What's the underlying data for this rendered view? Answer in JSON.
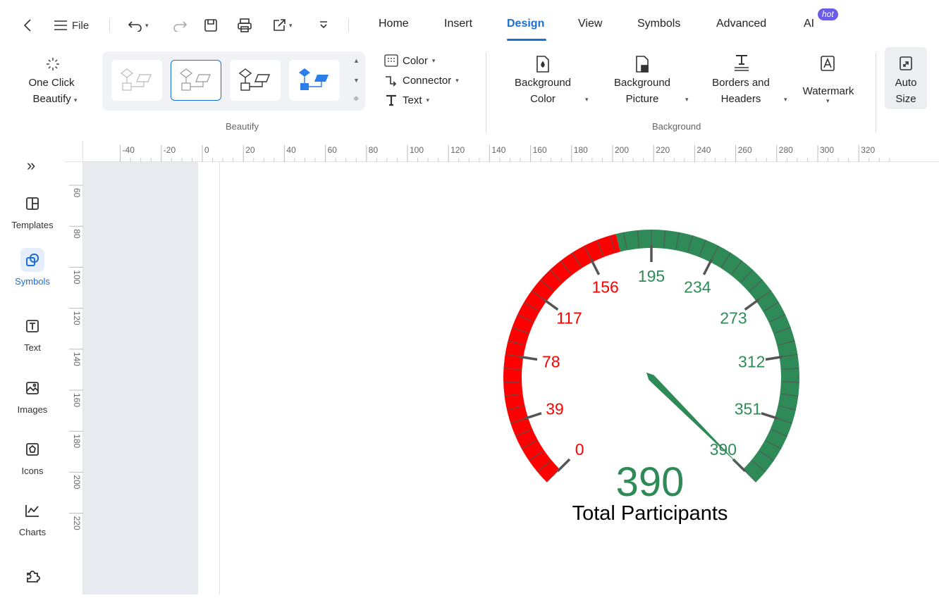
{
  "titlebar": {
    "back_icon": "chevron-left-icon",
    "file_label": "File",
    "tabs": [
      {
        "label": "Home"
      },
      {
        "label": "Insert"
      },
      {
        "label": "Design",
        "active": true
      },
      {
        "label": "View"
      },
      {
        "label": "Symbols"
      },
      {
        "label": "Advanced"
      },
      {
        "label": "AI"
      }
    ],
    "ai_badge": "hot"
  },
  "ribbon": {
    "beautify": {
      "one_click_line1": "One Click",
      "one_click_line2": "Beautify",
      "group_label": "Beautify"
    },
    "format_menu": {
      "color": "Color",
      "connector": "Connector",
      "text": "Text"
    },
    "background": {
      "bg_color_line1": "Background",
      "bg_color_line2": "Color",
      "bg_picture_line1": "Background",
      "bg_picture_line2": "Picture",
      "borders_line1": "Borders and",
      "borders_line2": "Headers",
      "watermark": "Watermark",
      "group_label": "Background"
    },
    "auto_size_line1": "Auto",
    "auto_size_line2": "Size"
  },
  "sidebar": {
    "items": [
      {
        "label": "Templates",
        "icon": "templates-icon"
      },
      {
        "label": "Symbols",
        "icon": "symbols-icon",
        "active": true
      },
      {
        "label": "Text",
        "icon": "text-icon"
      },
      {
        "label": "Images",
        "icon": "images-icon"
      },
      {
        "label": "Icons",
        "icon": "icons-icon"
      },
      {
        "label": "Charts",
        "icon": "charts-icon"
      }
    ]
  },
  "rulers": {
    "horizontal_labels": [
      "-40",
      "-20",
      "0",
      "20",
      "40",
      "60",
      "80",
      "100",
      "120",
      "140",
      "160",
      "180",
      "200",
      "220",
      "240",
      "260",
      "280",
      "300",
      "320"
    ],
    "vertical_labels": [
      "60",
      "80",
      "100",
      "120",
      "140",
      "160",
      "180",
      "200",
      "220"
    ]
  },
  "gauge": {
    "min": 0,
    "max": 390,
    "value": 390,
    "threshold": 175,
    "tick_labels": [
      "0",
      "39",
      "78",
      "117",
      "156",
      "195",
      "234",
      "273",
      "312",
      "351",
      "390"
    ],
    "value_text": "390",
    "caption": "Total Participants",
    "colors": {
      "low": "#ff0000",
      "high": "#2e8b57",
      "needle": "#2e8b57",
      "tick": "#555555"
    }
  }
}
